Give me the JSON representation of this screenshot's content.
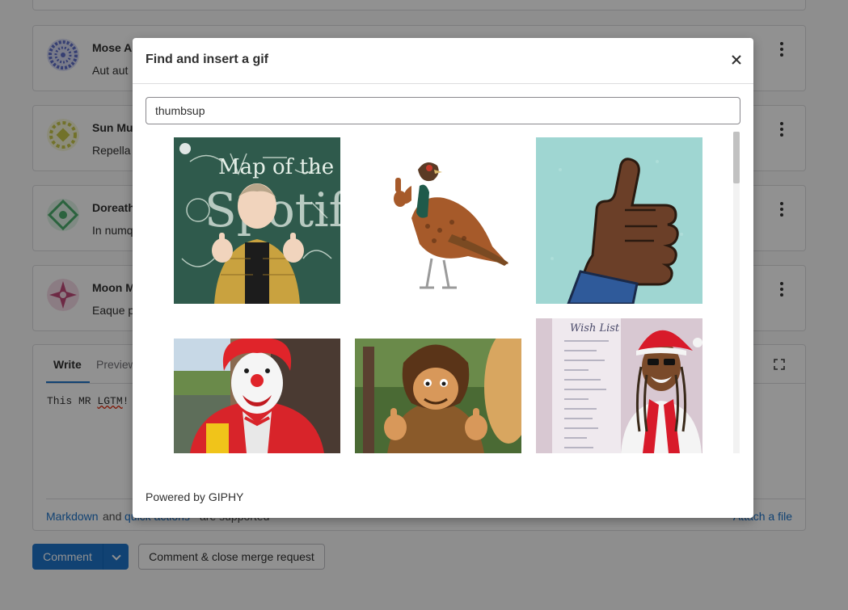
{
  "notes": [
    {
      "author": "Mose A",
      "body": "Aut aut",
      "avatar_color": "#5f6fc9"
    },
    {
      "author": "Sun Mu",
      "body": "Repella",
      "avatar_color": "#c8c84a"
    },
    {
      "author": "Doreath",
      "body": "In numq",
      "avatar_color": "#4caf6d"
    },
    {
      "author": "Moon M",
      "body": "Eaque p",
      "avatar_color": "#c24a7a"
    }
  ],
  "editor": {
    "tab_write": "Write",
    "tab_preview": "Preview",
    "content_prefix": "This MR ",
    "content_error_word": "LGTM",
    "content_suffix": "!",
    "markdown_link": "Markdown",
    "and_text": "and",
    "quick_actions_link": "quick actions",
    "supported_text": "are supported",
    "attach_file": "Attach a file"
  },
  "actions": {
    "comment": "Comment",
    "close_mr": "Comment & close merge request"
  },
  "modal": {
    "title": "Find and insert a gif",
    "search_value": "thumbsup",
    "powered_by": "Powered by GIPHY",
    "gifs": [
      {
        "name": "gif-kpop-thumbs-up"
      },
      {
        "name": "gif-pheasant-thumbs-up"
      },
      {
        "name": "gif-hand-thumbs-up"
      },
      {
        "name": "gif-clown-thumbs-up"
      },
      {
        "name": "gif-caveman-thumbs-up"
      },
      {
        "name": "gif-wish-list-thumbs-up"
      }
    ]
  },
  "colors": {
    "accent": "#1f75cb",
    "overlay": "rgba(0,0,0,0.43)"
  }
}
